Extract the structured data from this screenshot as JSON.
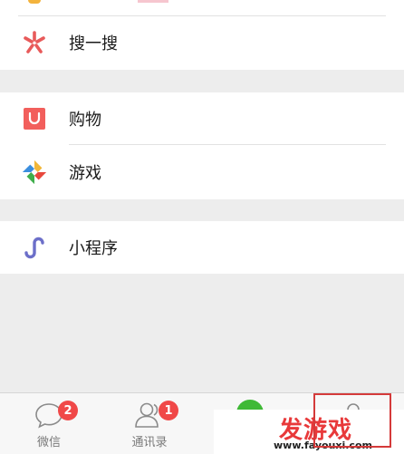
{
  "menu": {
    "search": {
      "label": "搜一搜",
      "icon": "sparkle-icon"
    },
    "shopping": {
      "label": "购物",
      "icon": "shopping-bag-icon"
    },
    "games": {
      "label": "游戏",
      "icon": "games-icon"
    },
    "miniprogram": {
      "label": "小程序",
      "icon": "mini-program-icon"
    }
  },
  "tabbar": {
    "chats": {
      "label": "微信",
      "badge": "2",
      "icon": "chat-bubble-icon"
    },
    "contacts": {
      "label": "通讯录",
      "badge": "1",
      "icon": "contacts-icon"
    },
    "discover": {
      "icon": "discover-icon"
    },
    "me": {
      "icon": "person-icon"
    }
  },
  "watermark": {
    "title": "发游戏",
    "url": "www.fayouxi.com"
  },
  "colors": {
    "accent_red": "#d43a3a",
    "badge_red": "#f04848",
    "discover_green": "#3fb936",
    "shopping_red": "#f25f5c",
    "miniprogram_purple": "#6c6fc9",
    "watermark_red": "#e8393a"
  }
}
